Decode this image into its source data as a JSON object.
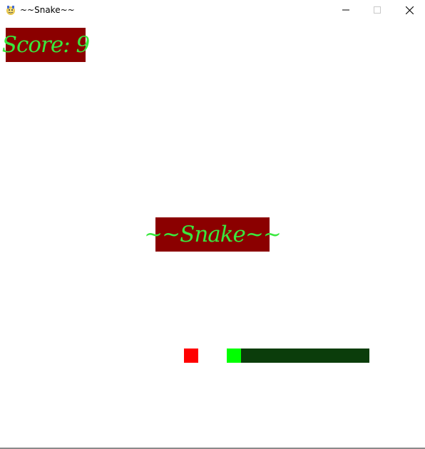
{
  "window": {
    "title": "~~Snake~~",
    "icon": "pygame-snake-icon"
  },
  "game": {
    "score_text": "Score: 9",
    "score": 9,
    "title_label": "~~Snake~~"
  },
  "colors": {
    "label_background": "#8b0000",
    "label_text": "#39e83d",
    "food": "#ff0000",
    "snake_head": "#00ff00",
    "snake_body": "#0b3d0b",
    "background": "#ffffff"
  }
}
